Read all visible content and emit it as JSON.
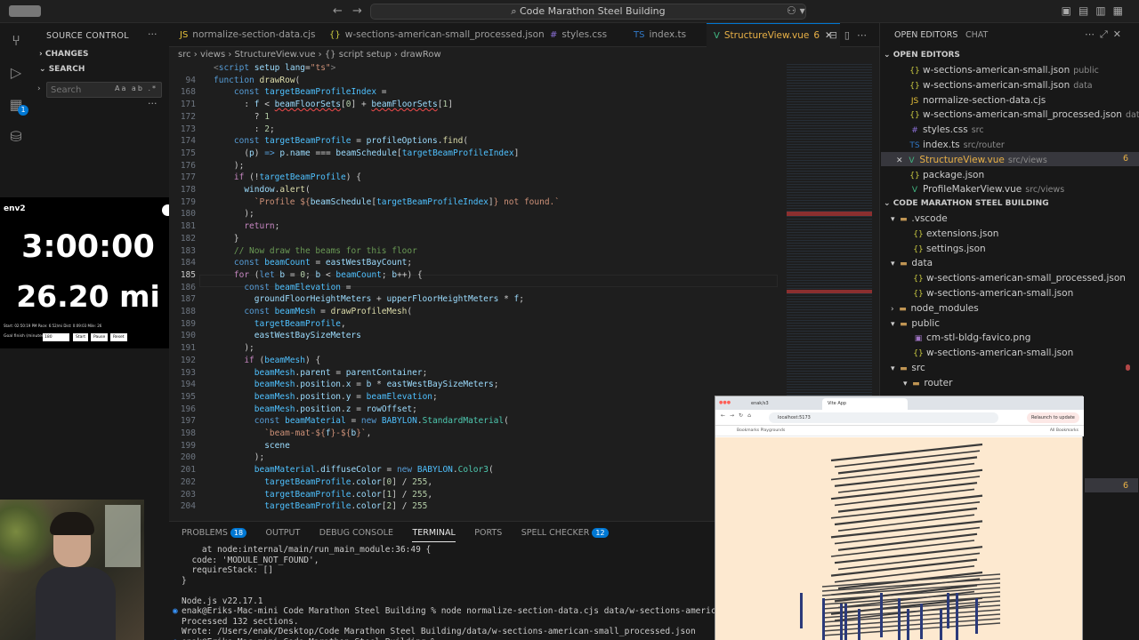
{
  "window": {
    "title": "Code Marathon Steel Building"
  },
  "sidebar": {
    "header": "SOURCE CONTROL",
    "sections": [
      "CHANGES",
      "SEARCH"
    ],
    "search": {
      "placeholder": "Search",
      "options": "Aa  ab  .*"
    },
    "activity_badge": "1"
  },
  "stream": {
    "label": "env2",
    "timer": "3:00:00",
    "distance": "26.20 mi",
    "stats": "Start: 02:50:19 PM   Pace: 6:52/mi   Dist: 0:09:03   Mile: 26",
    "goal_label": "Goal finish (minutes):",
    "goal_value": "180",
    "buttons": [
      "Start",
      "Pause",
      "Reset"
    ]
  },
  "tabs": [
    {
      "label": "normalize-section-data.cjs",
      "icon": "js-icon",
      "glyph": "JS"
    },
    {
      "label": "w-sections-american-small_processed.json",
      "icon": "json-icon",
      "glyph": "{}"
    },
    {
      "label": "styles.css",
      "icon": "css-icon",
      "glyph": "#"
    },
    {
      "label": "index.ts",
      "icon": "ts-icon",
      "glyph": "TS"
    },
    {
      "label": "StructureView.vue",
      "icon": "vue-icon",
      "glyph": "V",
      "problems": "6",
      "active": true
    }
  ],
  "breadcrumb": "src  ›  views  ›  StructureView.vue  ›  {} script setup  ›  drawRow",
  "editor": {
    "current_line": "185",
    "lines": [
      {
        "n": "",
        "html": "<span class='tag'>&lt;</span><span class='kw'>script</span> <span class='attr'>setup</span> <span class='attr'>lang</span>=<span class='str'>\"ts\"</span><span class='tag'>&gt;</span>"
      },
      {
        "n": "94",
        "html": "<span class='kw'>function</span> <span class='fn'>drawRow</span>("
      },
      {
        "n": "168",
        "html": "    <span class='kw'>const</span> <span class='cn'>targetBeamProfileIndex</span> ="
      },
      {
        "n": "171",
        "html": "      : <span class='vr'>f</span> &lt; <span class='vr err'>beamFloorSets</span>[<span class='num'>0</span>] + <span class='vr err'>beamFloorSets</span>[<span class='num'>1</span>]"
      },
      {
        "n": "172",
        "html": "        ? <span class='num'>1</span>"
      },
      {
        "n": "173",
        "html": "        : <span class='num'>2</span>;"
      },
      {
        "n": "174",
        "html": "    <span class='kw'>const</span> <span class='cn'>targetBeamProfile</span> = <span class='vr'>profileOptions</span>.<span class='fn'>find</span>("
      },
      {
        "n": "175",
        "html": "      (<span class='vr'>p</span>) <span class='kw'>=&gt;</span> <span class='vr'>p</span>.<span class='vr'>name</span> === <span class='vr'>beamSchedule</span>[<span class='cn'>targetBeamProfileIndex</span>]"
      },
      {
        "n": "176",
        "html": "    );"
      },
      {
        "n": "177",
        "html": "    <span class='ctl'>if</span> (!<span class='cn'>targetBeamProfile</span>) {"
      },
      {
        "n": "178",
        "html": "      <span class='vr'>window</span>.<span class='fn'>alert</span>("
      },
      {
        "n": "179",
        "html": "        <span class='str'>`Profile ${</span><span class='vr'>beamSchedule</span>[<span class='cn'>targetBeamProfileIndex</span>]<span class='str'>} not found.`</span>"
      },
      {
        "n": "180",
        "html": "      );"
      },
      {
        "n": "181",
        "html": "      <span class='ctl'>return</span>;"
      },
      {
        "n": "182",
        "html": "    }"
      },
      {
        "n": "183",
        "html": "    <span class='cm'>// Now draw the beams for this floor</span>"
      },
      {
        "n": "184",
        "html": "    <span class='kw'>const</span> <span class='cn'>beamCount</span> = <span class='vr'>eastWestBayCount</span>;"
      },
      {
        "n": "185",
        "html": "    <span class='ctl'>for</span> (<span class='kw'>let</span> <span class='vr'>b</span> = <span class='num'>0</span>; <span class='vr'>b</span> &lt; <span class='cn'>beamCount</span>; <span class='vr'>b</span>++) {"
      },
      {
        "n": "186",
        "html": "      <span class='kw'>const</span> <span class='cn'>beamElevation</span> ="
      },
      {
        "n": "187",
        "html": "        <span class='vr'>groundFloorHeightMeters</span> + <span class='vr'>upperFloorHeightMeters</span> * <span class='vr'>f</span>;"
      },
      {
        "n": "188",
        "html": "      <span class='kw'>const</span> <span class='cn'>beamMesh</span> = <span class='fn'>drawProfileMesh</span>("
      },
      {
        "n": "189",
        "html": "        <span class='cn'>targetBeamProfile</span>,"
      },
      {
        "n": "190",
        "html": "        <span class='vr'>eastWestBaySizeMeters</span>"
      },
      {
        "n": "191",
        "html": "      );"
      },
      {
        "n": "192",
        "html": "      <span class='ctl'>if</span> (<span class='cn'>beamMesh</span>) {"
      },
      {
        "n": "193",
        "html": "        <span class='cn'>beamMesh</span>.<span class='vr'>parent</span> = <span class='vr'>parentContainer</span>;"
      },
      {
        "n": "194",
        "html": "        <span class='cn'>beamMesh</span>.<span class='vr'>position</span>.<span class='vr'>x</span> = <span class='vr'>b</span> * <span class='vr'>eastWestBaySizeMeters</span>;"
      },
      {
        "n": "195",
        "html": "        <span class='cn'>beamMesh</span>.<span class='vr'>position</span>.<span class='vr'>y</span> = <span class='cn'>beamElevation</span>;"
      },
      {
        "n": "196",
        "html": "        <span class='cn'>beamMesh</span>.<span class='vr'>position</span>.<span class='vr'>z</span> = <span class='vr'>rowOffset</span>;"
      },
      {
        "n": "197",
        "html": "        <span class='kw'>const</span> <span class='cn'>beamMaterial</span> = <span class='kw'>new</span> <span class='cn'>BABYLON</span>.<span class='ty'>StandardMaterial</span>("
      },
      {
        "n": "198",
        "html": "          <span class='str'>`beam-mat-${</span><span class='vr'>f</span><span class='str'>}-${</span><span class='vr'>b</span><span class='str'>}`</span>,"
      },
      {
        "n": "199",
        "html": "          <span class='vr'>scene</span>"
      },
      {
        "n": "200",
        "html": "        );"
      },
      {
        "n": "201",
        "html": "        <span class='cn'>beamMaterial</span>.<span class='vr'>diffuseColor</span> = <span class='kw'>new</span> <span class='cn'>BABYLON</span>.<span class='ty'>Color3</span>("
      },
      {
        "n": "202",
        "html": "          <span class='cn'>targetBeamProfile</span>.<span class='vr'>color</span>[<span class='num'>0</span>] / <span class='num'>255</span>,"
      },
      {
        "n": "203",
        "html": "          <span class='cn'>targetBeamProfile</span>.<span class='vr'>color</span>[<span class='num'>1</span>] / <span class='num'>255</span>,"
      },
      {
        "n": "204",
        "html": "          <span class='cn'>targetBeamProfile</span>.<span class='vr'>color</span>[<span class='num'>2</span>] / <span class='num'>255</span>"
      }
    ]
  },
  "panel": {
    "tabs": [
      {
        "label": "PROBLEMS",
        "badge": "18"
      },
      {
        "label": "OUTPUT"
      },
      {
        "label": "DEBUG CONSOLE"
      },
      {
        "label": "TERMINAL",
        "active": true
      },
      {
        "label": "PORTS"
      },
      {
        "label": "SPELL CHECKER",
        "badge": "12"
      }
    ],
    "terminal_lines": [
      "    at node:internal/main/run_main_module:36:49 {",
      "  code: 'MODULE_NOT_FOUND',",
      "  requireStack: []",
      "}",
      "",
      "Node.js v22.17.1",
      "enak@Eriks-Mac-mini Code Marathon Steel Building % node normalize-section-data.cjs data/w-sections-american-smal",
      "Processed 132 sections.",
      "Wrote: /Users/enak/Desktop/Code Marathon Steel Building/data/w-sections-american-small_processed.json",
      "enak@Eriks-Mac-mini Code Marathon Steel Building % "
    ]
  },
  "right_panel": {
    "tabs": [
      "OPEN EDITORS",
      "CHAT"
    ],
    "open_editors_header": "OPEN EDITORS",
    "open_editors": [
      {
        "name": "w-sections-american-small.json",
        "hint": "public",
        "icon": "json-icon",
        "glyph": "{}"
      },
      {
        "name": "w-sections-american-small.json",
        "hint": "data",
        "icon": "json-icon",
        "glyph": "{}"
      },
      {
        "name": "normalize-section-data.cjs",
        "hint": "",
        "icon": "js-icon",
        "glyph": "JS"
      },
      {
        "name": "w-sections-american-small_processed.json",
        "hint": "data",
        "icon": "json-icon",
        "glyph": "{}"
      },
      {
        "name": "styles.css",
        "hint": "src",
        "icon": "css-icon",
        "glyph": "#"
      },
      {
        "name": "index.ts",
        "hint": "src/router",
        "icon": "ts-icon",
        "glyph": "TS"
      },
      {
        "name": "StructureView.vue",
        "hint": "src/views",
        "icon": "vue-icon",
        "glyph": "V",
        "count": "6",
        "active": true
      },
      {
        "name": "package.json",
        "hint": "",
        "icon": "json-icon",
        "glyph": "{}"
      },
      {
        "name": "ProfileMakerView.vue",
        "hint": "src/views",
        "icon": "vue-icon",
        "glyph": "V"
      }
    ],
    "explorer_header": "CODE MARATHON STEEL BUILDING",
    "tree": [
      {
        "name": ".vscode",
        "type": "folder",
        "indent": 1,
        "glyph": "▾"
      },
      {
        "name": "extensions.json",
        "type": "json",
        "indent": 2,
        "glyph": "{}"
      },
      {
        "name": "settings.json",
        "type": "json",
        "indent": 2,
        "glyph": "{}"
      },
      {
        "name": "data",
        "type": "folder",
        "indent": 1,
        "glyph": "▾"
      },
      {
        "name": "w-sections-american-small_processed.json",
        "type": "json",
        "indent": 2,
        "glyph": "{}"
      },
      {
        "name": "w-sections-american-small.json",
        "type": "json",
        "indent": 2,
        "glyph": "{}"
      },
      {
        "name": "node_modules",
        "type": "folder",
        "indent": 1,
        "glyph": "›"
      },
      {
        "name": "public",
        "type": "folder",
        "indent": 1,
        "glyph": "▾"
      },
      {
        "name": "cm-stl-bldg-favico.png",
        "type": "png",
        "indent": 2,
        "glyph": "▣"
      },
      {
        "name": "w-sections-american-small.json",
        "type": "json",
        "indent": 2,
        "glyph": "{}"
      },
      {
        "name": "src",
        "type": "folder",
        "indent": 1,
        "glyph": "▾",
        "modified": true
      },
      {
        "name": "router",
        "type": "folder",
        "indent": 2,
        "glyph": "▾"
      }
    ],
    "lower_count": "6"
  },
  "browser": {
    "tabs": [
      "enak/s3",
      "Vite App"
    ],
    "url": "localhost:5173",
    "relaunch": "Relaunch to update",
    "bookmarks_left": "Bookmarks   Playgrounds",
    "bookmarks_right": "All Bookmarks"
  },
  "colors": {
    "accent": "#0078d4",
    "modified": "#e8b046",
    "scene_bg": "#fde9d0",
    "beam": "#3a3a3a",
    "column": "#2b3a7a"
  }
}
